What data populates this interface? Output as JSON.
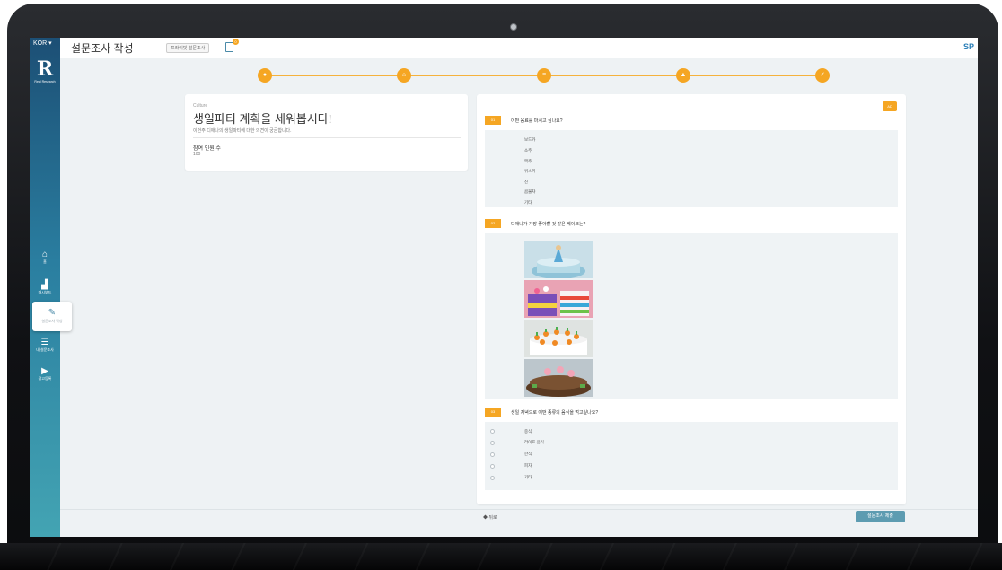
{
  "app": {
    "language": "KOR ▾",
    "logo_letter": "R",
    "logo_text": "Real Research",
    "page_title": "설문조사 작성",
    "title_badge": "프라이빗 설문조사",
    "doc_badge_count": "0",
    "avatar": "SP"
  },
  "sidebar": {
    "items": [
      {
        "label": "홈",
        "icon": "home-icon"
      },
      {
        "label": "대시보드",
        "icon": "chart-icon"
      },
      {
        "label": "설문조사 작성",
        "icon": "pencil-icon"
      },
      {
        "label": "내 설문조사",
        "icon": "list-icon"
      },
      {
        "label": "광고등록",
        "icon": "play-icon"
      }
    ]
  },
  "stepper": {
    "steps": [
      {
        "icon": "eye-icon",
        "glyph": "●"
      },
      {
        "icon": "bank-icon",
        "glyph": "⌂"
      },
      {
        "icon": "list-icon",
        "glyph": "≡"
      },
      {
        "icon": "lock-icon",
        "glyph": "▲"
      },
      {
        "icon": "check-icon",
        "glyph": "✓"
      }
    ]
  },
  "survey": {
    "category": "Culture",
    "title": "생일파티 계획을 세워봅시다!",
    "description": "이번주 디애나의 생일파티에 대한 의견이 궁금합니다.",
    "participants_label": "참여 인원 수",
    "participants_value": "100"
  },
  "questions": {
    "ad_badge": "AD",
    "q1": {
      "number": "01",
      "text": "어떤 음료를 마시고 싶나요?",
      "options": [
        "보드카",
        "소주",
        "맥주",
        "위스키",
        "진",
        "콤불챠",
        "기타"
      ]
    },
    "q2": {
      "number": "02",
      "text": "디애나가 가장 좋아할 것 같은 케이크는?"
    },
    "q3": {
      "number": "03",
      "text": "생일 저녁으로 어떤 종류의 음식을 먹고싶나요?",
      "options": [
        "중식",
        "라이프 음식",
        "한식",
        "피자",
        "기타"
      ]
    }
  },
  "footer": {
    "back_label": "◆ 뒤로",
    "submit_label": "설문조사 제출"
  },
  "colors": {
    "accent": "#f5a623",
    "sidebar_top": "#1c4f75",
    "sidebar_bottom": "#43a4b3",
    "submit": "#5d9cb1"
  }
}
